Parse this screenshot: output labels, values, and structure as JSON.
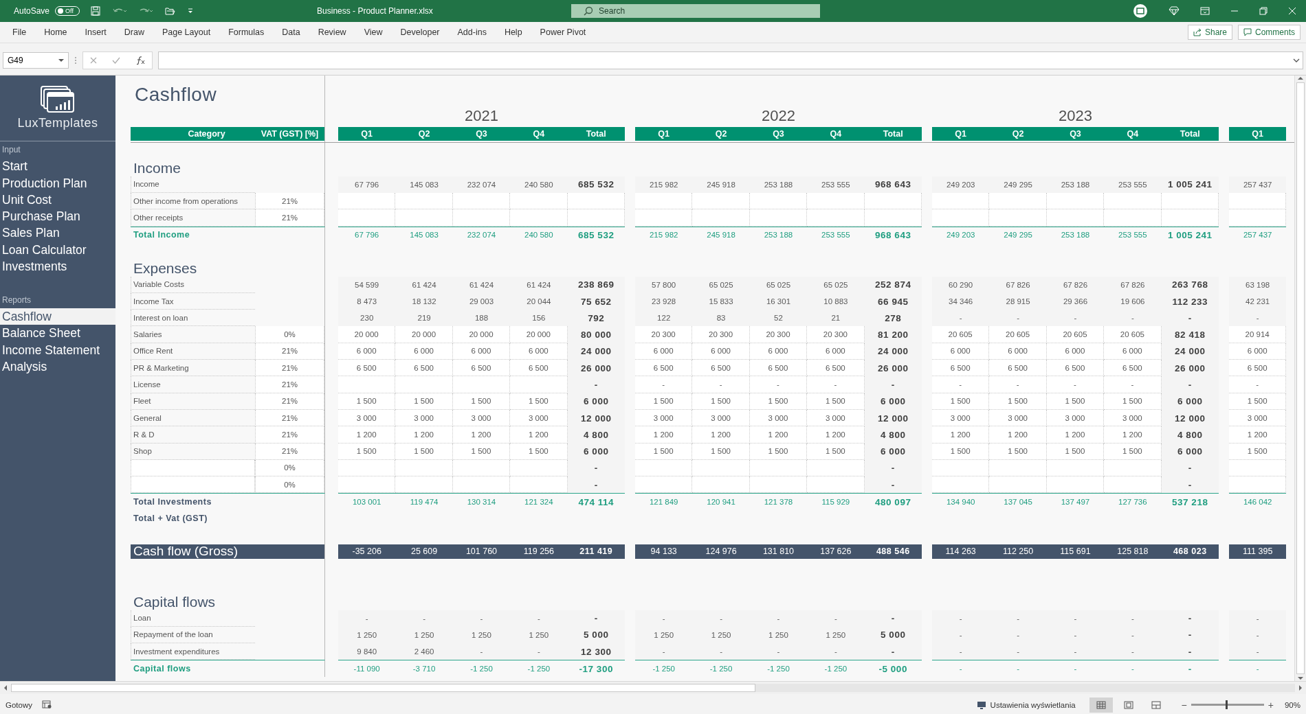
{
  "title_bar": {
    "autosave_label": "AutoSave",
    "autosave": {
      "on": false,
      "label": "Off"
    },
    "title": "Business - Product Planner.xlsx",
    "search": {
      "placeholder": "Search"
    }
  },
  "ribbon_tabs": [
    "File",
    "Home",
    "Insert",
    "Draw",
    "Page Layout",
    "Formulas",
    "Data",
    "Review",
    "View",
    "Developer",
    "Add-ins",
    "Help",
    "Power Pivot"
  ],
  "ribbon_buttons": [
    "Share",
    "Comments"
  ],
  "formula_bar": {
    "name_box": "G49"
  },
  "sidebar": {
    "logo": "LuxTemplates",
    "sections": [
      {
        "title": "Input",
        "items": [
          {
            "label": "Start",
            "selected": false
          },
          {
            "label": "Production Plan",
            "selected": false
          },
          {
            "label": "Unit Cost",
            "selected": false
          },
          {
            "label": "Purchase Plan",
            "selected": false
          },
          {
            "label": "Sales Plan",
            "selected": false
          },
          {
            "label": "Loan Calculator",
            "selected": false
          },
          {
            "label": "Investments",
            "selected": false
          }
        ]
      },
      {
        "title": "Reports",
        "items": [
          {
            "label": "Cashflow",
            "selected": true
          },
          {
            "label": "Balance Sheet",
            "selected": false
          },
          {
            "label": "Income Statement",
            "selected": false
          },
          {
            "label": "Analysis",
            "selected": false
          }
        ]
      }
    ]
  },
  "sheet": {
    "title": "Cashflow",
    "columns": [
      "Category",
      "VAT (GST) [%]"
    ],
    "groups": [
      {
        "year": "2021",
        "columns": [
          {
            "label": "Q1",
            "kind": "quarter"
          },
          {
            "label": "Q2",
            "kind": "quarter"
          },
          {
            "label": "Q3",
            "kind": "quarter"
          },
          {
            "label": "Q4",
            "kind": "quarter"
          },
          {
            "label": "Total",
            "kind": "total"
          }
        ]
      },
      {
        "year": "2022",
        "columns": [
          {
            "label": "Q1",
            "kind": "quarter"
          },
          {
            "label": "Q2",
            "kind": "quarter"
          },
          {
            "label": "Q3",
            "kind": "quarter"
          },
          {
            "label": "Q4",
            "kind": "quarter"
          },
          {
            "label": "Total",
            "kind": "total"
          }
        ]
      },
      {
        "year": "2023",
        "columns": [
          {
            "label": "Q1",
            "kind": "quarter"
          },
          {
            "label": "Q2",
            "kind": "quarter"
          },
          {
            "label": "Q3",
            "kind": "quarter"
          },
          {
            "label": "Q4",
            "kind": "quarter"
          },
          {
            "label": "Total",
            "kind": "total"
          }
        ]
      },
      {
        "columns": [
          {
            "label": "Q1",
            "kind": "quarter"
          }
        ]
      }
    ],
    "rows": [
      {
        "kind": "blank"
      },
      {
        "kind": "section",
        "label": "Income"
      },
      {
        "kind": "item",
        "label": "Income",
        "input": false,
        "values": [
          {
            "quarters": [
              "67 796",
              "145 083",
              "232 074",
              "240 580"
            ],
            "total": "685 532"
          },
          {
            "quarters": [
              "215 982",
              "245 918",
              "253 188",
              "253 555"
            ],
            "total": "968 643"
          },
          {
            "quarters": [
              "249 203",
              "249 295",
              "253 188",
              "253 555"
            ],
            "total": "1 005 241"
          },
          {
            "quarters": [
              "257 437"
            ]
          }
        ]
      },
      {
        "kind": "item",
        "label": "Other income from operations",
        "vat": "21%",
        "input": true
      },
      {
        "kind": "item",
        "label": "Other receipts",
        "vat": "21%",
        "input": true
      },
      {
        "kind": "total",
        "label": "Total Income",
        "highlight": true,
        "values": [
          {
            "quarters": [
              "67 796",
              "145 083",
              "232 074",
              "240 580"
            ],
            "total": "685 532"
          },
          {
            "quarters": [
              "215 982",
              "245 918",
              "253 188",
              "253 555"
            ],
            "total": "968 643"
          },
          {
            "quarters": [
              "249 203",
              "249 295",
              "253 188",
              "253 555"
            ],
            "total": "1 005 241"
          },
          {
            "quarters": [
              "257 437"
            ]
          }
        ]
      },
      {
        "kind": "blank"
      },
      {
        "kind": "section",
        "label": "Expenses"
      },
      {
        "kind": "item",
        "label": "Variable Costs",
        "input": false,
        "values": [
          {
            "quarters": [
              "54 599",
              "61 424",
              "61 424",
              "61 424"
            ],
            "total": "238 869"
          },
          {
            "quarters": [
              "57 800",
              "65 025",
              "65 025",
              "65 025"
            ],
            "total": "252 874"
          },
          {
            "quarters": [
              "60 290",
              "67 826",
              "67 826",
              "67 826"
            ],
            "total": "263 768"
          },
          {
            "quarters": [
              "63 198"
            ]
          }
        ]
      },
      {
        "kind": "item",
        "label": "Income Tax",
        "input": false,
        "values": [
          {
            "quarters": [
              "8 473",
              "18 132",
              "29 003",
              "20 044"
            ],
            "total": "75 652"
          },
          {
            "quarters": [
              "23 928",
              "15 833",
              "16 301",
              "10 883"
            ],
            "total": "66 945"
          },
          {
            "quarters": [
              "34 346",
              "28 915",
              "29 366",
              "19 606"
            ],
            "total": "112 233"
          },
          {
            "quarters": [
              "42 231"
            ]
          }
        ]
      },
      {
        "kind": "item",
        "label": "Interest on loan",
        "input": false,
        "values": [
          {
            "quarters": [
              "230",
              "219",
              "188",
              "156"
            ],
            "total": "792"
          },
          {
            "quarters": [
              "122",
              "83",
              "52",
              "21"
            ],
            "total": "278"
          },
          {
            "quarters": [
              "-",
              "-",
              "-",
              "-"
            ],
            "total": "-"
          },
          {
            "quarters": [
              "-"
            ]
          }
        ]
      },
      {
        "kind": "item",
        "label": "Salaries",
        "vat": "0%",
        "input": true,
        "values": [
          {
            "quarters": [
              "20 000",
              "20 000",
              "20 000",
              "20 000"
            ],
            "total": "80 000"
          },
          {
            "quarters": [
              "20 300",
              "20 300",
              "20 300",
              "20 300"
            ],
            "total": "81 200"
          },
          {
            "quarters": [
              "20 605",
              "20 605",
              "20 605",
              "20 605"
            ],
            "total": "82 418"
          },
          {
            "quarters": [
              "20 914"
            ]
          }
        ]
      },
      {
        "kind": "item",
        "label": "Office Rent",
        "vat": "21%",
        "input": true,
        "values": [
          {
            "quarters": [
              "6 000",
              "6 000",
              "6 000",
              "6 000"
            ],
            "total": "24 000"
          },
          {
            "quarters": [
              "6 000",
              "6 000",
              "6 000",
              "6 000"
            ],
            "total": "24 000"
          },
          {
            "quarters": [
              "6 000",
              "6 000",
              "6 000",
              "6 000"
            ],
            "total": "24 000"
          },
          {
            "quarters": [
              "6 000"
            ]
          }
        ]
      },
      {
        "kind": "item",
        "label": "PR & Marketing",
        "vat": "21%",
        "input": true,
        "values": [
          {
            "quarters": [
              "6 500",
              "6 500",
              "6 500",
              "6 500"
            ],
            "total": "26 000"
          },
          {
            "quarters": [
              "6 500",
              "6 500",
              "6 500",
              "6 500"
            ],
            "total": "26 000"
          },
          {
            "quarters": [
              "6 500",
              "6 500",
              "6 500",
              "6 500"
            ],
            "total": "26 000"
          },
          {
            "quarters": [
              "6 500"
            ]
          }
        ]
      },
      {
        "kind": "item",
        "label": "License",
        "vat": "21%",
        "input": true,
        "values": [
          {
            "total": "-"
          },
          {
            "quarters": [
              "-",
              "-",
              "-",
              "-"
            ],
            "total": "-"
          },
          {
            "quarters": [
              "-",
              "-",
              "-",
              "-"
            ],
            "total": "-"
          },
          {
            "quarters": [
              "-"
            ]
          }
        ]
      },
      {
        "kind": "item",
        "label": "Fleet",
        "vat": "21%",
        "input": true,
        "values": [
          {
            "quarters": [
              "1 500",
              "1 500",
              "1 500",
              "1 500"
            ],
            "total": "6 000"
          },
          {
            "quarters": [
              "1 500",
              "1 500",
              "1 500",
              "1 500"
            ],
            "total": "6 000"
          },
          {
            "quarters": [
              "1 500",
              "1 500",
              "1 500",
              "1 500"
            ],
            "total": "6 000"
          },
          {
            "quarters": [
              "1 500"
            ]
          }
        ]
      },
      {
        "kind": "item",
        "label": "General",
        "vat": "21%",
        "input": true,
        "values": [
          {
            "quarters": [
              "3 000",
              "3 000",
              "3 000",
              "3 000"
            ],
            "total": "12 000"
          },
          {
            "quarters": [
              "3 000",
              "3 000",
              "3 000",
              "3 000"
            ],
            "total": "12 000"
          },
          {
            "quarters": [
              "3 000",
              "3 000",
              "3 000",
              "3 000"
            ],
            "total": "12 000"
          },
          {
            "quarters": [
              "3 000"
            ]
          }
        ]
      },
      {
        "kind": "item",
        "label": "R & D",
        "vat": "21%",
        "input": true,
        "values": [
          {
            "quarters": [
              "1 200",
              "1 200",
              "1 200",
              "1 200"
            ],
            "total": "4 800"
          },
          {
            "quarters": [
              "1 200",
              "1 200",
              "1 200",
              "1 200"
            ],
            "total": "4 800"
          },
          {
            "quarters": [
              "1 200",
              "1 200",
              "1 200",
              "1 200"
            ],
            "total": "4 800"
          },
          {
            "quarters": [
              "1 200"
            ]
          }
        ]
      },
      {
        "kind": "item",
        "label": "Shop",
        "vat": "21%",
        "input": true,
        "values": [
          {
            "quarters": [
              "1 500",
              "1 500",
              "1 500",
              "1 500"
            ],
            "total": "6 000"
          },
          {
            "quarters": [
              "1 500",
              "1 500",
              "1 500",
              "1 500"
            ],
            "total": "6 000"
          },
          {
            "quarters": [
              "1 500",
              "1 500",
              "1 500",
              "1 500"
            ],
            "total": "6 000"
          },
          {
            "quarters": [
              "1 500"
            ]
          }
        ]
      },
      {
        "kind": "item",
        "vat": "0%",
        "input": true,
        "values": [
          {
            "total": "-"
          },
          {
            "total": "-"
          },
          {
            "total": "-"
          }
        ]
      },
      {
        "kind": "item",
        "vat": "0%",
        "input": true,
        "values": [
          {
            "total": "-"
          },
          {
            "total": "-"
          },
          {
            "total": "-"
          }
        ]
      },
      {
        "kind": "total",
        "label": "Total Investments",
        "highlight": false,
        "values": [
          {
            "quarters": [
              "103 001",
              "119 474",
              "130 314",
              "121 324"
            ],
            "total": "474 114"
          },
          {
            "quarters": [
              "121 849",
              "120 941",
              "121 378",
              "115 929"
            ],
            "total": "480 097"
          },
          {
            "quarters": [
              "134 940",
              "137 045",
              "137 497",
              "127 736"
            ],
            "total": "537 218"
          },
          {
            "quarters": [
              "146 042"
            ]
          }
        ]
      },
      {
        "kind": "subtotal",
        "label": "Total + Vat (GST)"
      },
      {
        "kind": "blank"
      },
      {
        "kind": "band",
        "label": "Cash flow (Gross)",
        "values": [
          {
            "quarters": [
              "-35 206",
              "25 609",
              "101 760",
              "119 256"
            ],
            "total": "211 419"
          },
          {
            "quarters": [
              "94 133",
              "124 976",
              "131 810",
              "137 626"
            ],
            "total": "488 546"
          },
          {
            "quarters": [
              "114 263",
              "112 250",
              "115 691",
              "125 818"
            ],
            "total": "468 023"
          },
          {
            "quarters": [
              "111 395"
            ]
          }
        ]
      },
      {
        "kind": "blank"
      },
      {
        "kind": "blank"
      },
      {
        "kind": "section",
        "label": "Capital flows"
      },
      {
        "kind": "item",
        "label": "Loan",
        "input": false,
        "values": [
          {
            "quarters": [
              "-",
              "-",
              "-",
              "-"
            ],
            "total": "-"
          },
          {
            "quarters": [
              "-",
              "-",
              "-",
              "-"
            ],
            "total": "-"
          },
          {
            "quarters": [
              "-",
              "-",
              "-",
              "-"
            ],
            "total": "-"
          },
          {
            "quarters": [
              "-"
            ]
          }
        ]
      },
      {
        "kind": "item",
        "label": "Repayment of the loan",
        "input": false,
        "values": [
          {
            "quarters": [
              "1 250",
              "1 250",
              "1 250",
              "1 250"
            ],
            "total": "5 000"
          },
          {
            "quarters": [
              "1 250",
              "1 250",
              "1 250",
              "1 250"
            ],
            "total": "5 000"
          },
          {
            "quarters": [
              "-",
              "-",
              "-",
              "-"
            ],
            "total": "-"
          },
          {
            "quarters": [
              "-"
            ]
          }
        ]
      },
      {
        "kind": "item",
        "label": "Investment expenditures",
        "input": false,
        "values": [
          {
            "quarters": [
              "9 840",
              "2 460",
              "-",
              "-"
            ],
            "total": "12 300"
          },
          {
            "quarters": [
              "-",
              "-",
              "-",
              "-"
            ],
            "total": "-"
          },
          {
            "quarters": [
              "-",
              "-",
              "-",
              "-"
            ],
            "total": "-"
          },
          {
            "quarters": [
              "-"
            ]
          }
        ]
      },
      {
        "kind": "total",
        "label": "Capital flows",
        "highlight": true,
        "values": [
          {
            "quarters": [
              "-11 090",
              "-3 710",
              "-1 250",
              "-1 250"
            ],
            "total": "-17 300"
          },
          {
            "quarters": [
              "-1 250",
              "-1 250",
              "-1 250",
              "-1 250"
            ],
            "total": "-5 000"
          },
          {
            "quarters": [
              "-",
              "-",
              "-",
              "-"
            ],
            "total": "-"
          },
          {
            "quarters": [
              "-"
            ]
          }
        ]
      }
    ]
  },
  "status_bar": {
    "status": "Gotowy",
    "display_settings": "Ustawienia wyświetlania",
    "views": [
      {
        "kind": "normal",
        "selected": true
      },
      {
        "kind": "page-layout",
        "selected": false
      },
      {
        "kind": "page-break",
        "selected": false
      }
    ],
    "zoom_out": "−",
    "zoom_in": "+",
    "zoom": {
      "level": 0.48,
      "label": "90%"
    }
  }
}
